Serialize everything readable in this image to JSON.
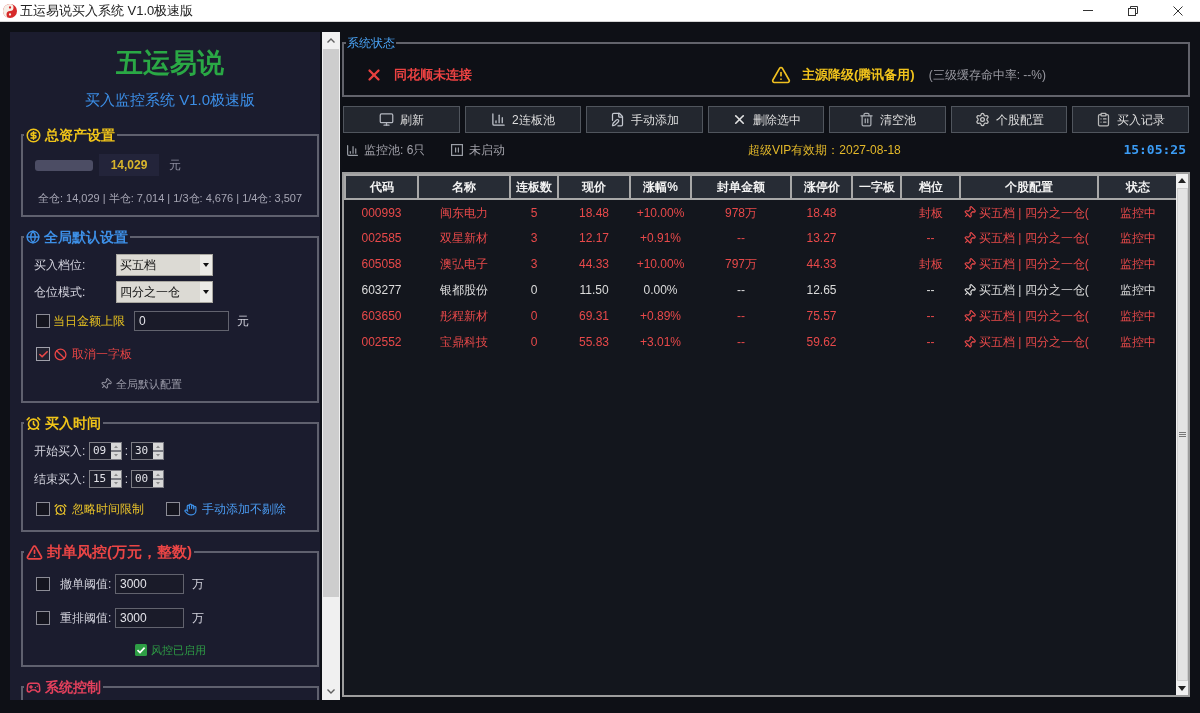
{
  "window": {
    "title": "五运易说买入系统 V1.0极速版"
  },
  "sidebar": {
    "brand": "五运易说",
    "subtitle": "买入监控系统 V1.0极速版",
    "assets": {
      "title": "总资产设置",
      "value": "14,029",
      "unit": "元",
      "summary": "全仓: 14,029 | 半仓: 7,014 | 1/3仓: 4,676 | 1/4仓: 3,507"
    },
    "defaults": {
      "title": "全局默认设置",
      "selects": [
        {
          "label": "买入档位:",
          "value": "买五档"
        },
        {
          "label": "仓位模式:",
          "value": "四分之一仓"
        }
      ],
      "daily_limit": {
        "label": "当日金额上限",
        "checked": false,
        "value": "0",
        "unit": "元"
      },
      "skip_limit_up": {
        "label": "取消一字板",
        "checked": true
      },
      "footer": "全局默认配置"
    },
    "buy_time": {
      "title": "买入时间",
      "ranges": [
        {
          "label": "开始买入:",
          "hour": "09",
          "separator": ":",
          "minute": "30"
        },
        {
          "label": "结束买入:",
          "hour": "15",
          "separator": ":",
          "minute": "00"
        }
      ],
      "options": [
        {
          "kind": "clock",
          "label": "忽略时间限制",
          "checked": false
        },
        {
          "kind": "hand",
          "label": "手动添加不剔除",
          "checked": false
        }
      ]
    },
    "risk": {
      "title": "封单风控(万元，整数)",
      "thresholds": [
        {
          "label": "撤单阈值:",
          "checked": false,
          "value": "3000",
          "unit": "万"
        },
        {
          "label": "重排阈值:",
          "checked": false,
          "value": "3000",
          "unit": "万"
        }
      ],
      "status": {
        "label": "风控已启用",
        "on": true
      }
    },
    "control": {
      "title": "系统控制"
    }
  },
  "system_status": {
    "title": "系统状态",
    "items": [
      {
        "kind": "error",
        "text": "同花顺未连接"
      },
      {
        "kind": "warning",
        "text": "主源降级(腾讯备用)",
        "note": "(三级缓存命中率: --%)"
      }
    ]
  },
  "toolbar": [
    {
      "kind": "refresh",
      "label": "刷新"
    },
    {
      "kind": "pool",
      "label": "2连板池"
    },
    {
      "kind": "add",
      "label": "手动添加"
    },
    {
      "kind": "delete",
      "label": "删除选中"
    },
    {
      "kind": "clear",
      "label": "清空池"
    },
    {
      "kind": "config",
      "label": "个股配置"
    },
    {
      "kind": "records",
      "label": "买入记录"
    }
  ],
  "info_bar": {
    "pool_count": "监控池: 6只",
    "run_state": "未启动",
    "vip": "超级VIP有效期：2027-08-18",
    "clock": "15:05:25"
  },
  "table": {
    "columns": [
      "代码",
      "名称",
      "连板数",
      "现价",
      "涨幅%",
      "封单金额",
      "涨停价",
      "一字板",
      "档位",
      "个股配置",
      "状态"
    ],
    "rows": [
      {
        "color": "#e8494a",
        "code": "000993",
        "name": "闽东电力",
        "streak": "5",
        "price": "18.48",
        "change": "+10.00%",
        "seal_amount": "978万",
        "limit_price": "18.48",
        "board_state": "封板",
        "config": "买五档 | 四分之一仓(",
        "status": "监控中"
      },
      {
        "color": "#e8494a",
        "code": "002585",
        "name": "双星新材",
        "streak": "3",
        "price": "12.17",
        "change": "+0.91%",
        "seal_amount": "--",
        "limit_price": "13.27",
        "board_state": "--",
        "config": "买五档 | 四分之一仓(",
        "status": "监控中"
      },
      {
        "color": "#e8494a",
        "code": "605058",
        "name": "澳弘电子",
        "streak": "3",
        "price": "44.33",
        "change": "+10.00%",
        "seal_amount": "797万",
        "limit_price": "44.33",
        "board_state": "封板",
        "config": "买五档 | 四分之一仓(",
        "status": "监控中"
      },
      {
        "color": "#dcdcdc",
        "code": "603277",
        "name": "银都股份",
        "streak": "0",
        "price": "11.50",
        "change": "0.00%",
        "seal_amount": "--",
        "limit_price": "12.65",
        "board_state": "--",
        "config": "买五档 | 四分之一仓(",
        "status": "监控中"
      },
      {
        "color": "#e8494a",
        "code": "603650",
        "name": "彤程新材",
        "streak": "0",
        "price": "69.31",
        "change": "+0.89%",
        "seal_amount": "--",
        "limit_price": "75.57",
        "board_state": "--",
        "config": "买五档 | 四分之一仓(",
        "status": "监控中"
      },
      {
        "color": "#e8494a",
        "code": "002552",
        "name": "宝鼎科技",
        "streak": "0",
        "price": "55.83",
        "change": "+3.01%",
        "seal_amount": "--",
        "limit_price": "59.62",
        "board_state": "--",
        "config": "买五档 | 四分之一仓(",
        "status": "监控中"
      }
    ]
  }
}
